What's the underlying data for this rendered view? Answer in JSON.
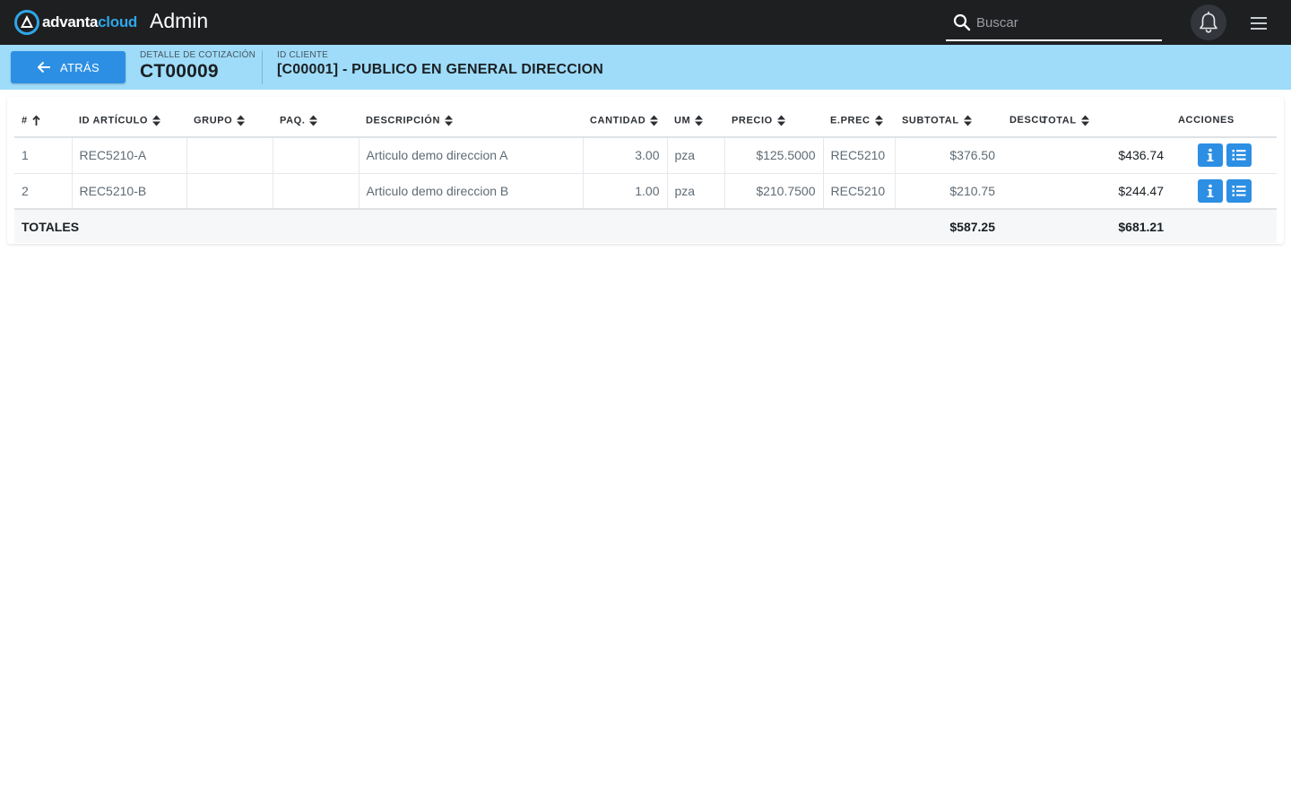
{
  "app": {
    "logo_text_main": "advanta",
    "logo_text_accent": "cloud",
    "title": "Admin",
    "brand_accent_color": "#2fa6e8"
  },
  "search": {
    "placeholder": "Buscar",
    "value": ""
  },
  "header_icons": {
    "notifications": "bell-icon",
    "menu": "hamburger-menu-icon"
  },
  "subheader": {
    "back_label": "ATRÁS",
    "detail_label": "DETALLE DE COTIZACIÓN",
    "quote_id": "CT00009",
    "client_label": "ID CLIENTE",
    "client_name": "[C00001] - PUBLICO EN GENERAL DIRECCION"
  },
  "table": {
    "columns": [
      {
        "key": "num",
        "label": "#",
        "sort": "asc"
      },
      {
        "key": "id_articulo",
        "label": "ID ARTÍCULO",
        "sort": "none"
      },
      {
        "key": "grupo",
        "label": "GRUPO",
        "sort": "none"
      },
      {
        "key": "paq",
        "label": "PAQ.",
        "sort": "none"
      },
      {
        "key": "descripcion",
        "label": "DESCRIPCIÓN",
        "sort": "none"
      },
      {
        "key": "cantidad",
        "label": "CANTIDAD",
        "sort": "none"
      },
      {
        "key": "um",
        "label": "UM",
        "sort": "none"
      },
      {
        "key": "precio",
        "label": "PRECIO",
        "sort": "none"
      },
      {
        "key": "eprec",
        "label": "E.PREC",
        "sort": "none"
      },
      {
        "key": "subtotal",
        "label": "SUBTOTAL",
        "sort": "none"
      },
      {
        "key": "descu",
        "label": "DESCU",
        "sort": "none"
      },
      {
        "key": "total",
        "label": "TOTAL",
        "sort": "none"
      },
      {
        "key": "acciones",
        "label": "ACCIONES",
        "sort": "none"
      }
    ],
    "rows": [
      {
        "num": "1",
        "id_articulo": "REC5210-A",
        "grupo": "",
        "paq": "",
        "descripcion": "Articulo demo direccion A",
        "cantidad": "3.00",
        "um": "pza",
        "precio": "$125.5000",
        "eprec": "REC5210",
        "subtotal": "$376.50",
        "descu": "",
        "total": "$436.74"
      },
      {
        "num": "2",
        "id_articulo": "REC5210-B",
        "grupo": "",
        "paq": "",
        "descripcion": "Articulo demo direccion B",
        "cantidad": "1.00",
        "um": "pza",
        "precio": "$210.7500",
        "eprec": "REC5210",
        "subtotal": "$210.75",
        "descu": "",
        "total": "$244.47"
      }
    ],
    "row_actions": [
      "info-icon",
      "list-icon"
    ],
    "totals": {
      "label": "TOTALES",
      "subtotal": "$587.25",
      "total": "$681.21"
    }
  },
  "colors": {
    "topbar": "#1e1f21",
    "subheader": "#9fdcf9",
    "primary_button": "#2d8fe3"
  }
}
